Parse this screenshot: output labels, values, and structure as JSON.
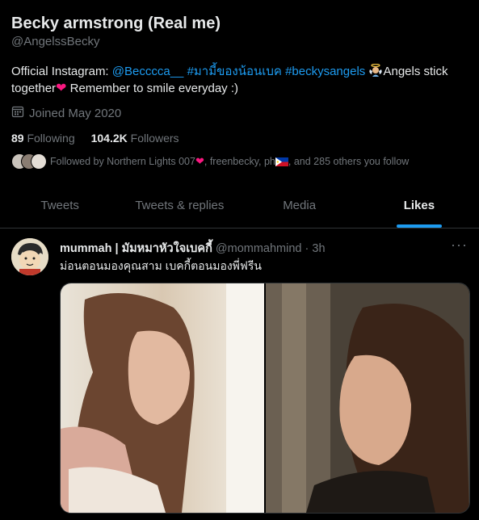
{
  "profile": {
    "name": "Becky armstrong (Real me)",
    "handle": "@AngelssBecky",
    "bio_prefix": "Official Instagram: ",
    "bio_link1": "@Becccca__",
    "bio_link2": "#มามี้ของน้อนเบค",
    "bio_link3": "#beckysangels",
    "bio_after_links": "Angels stick together",
    "bio_end": " Remember to smile everyday :)",
    "joined": "Joined May 2020",
    "following_count": "89",
    "following_label": "Following",
    "followers_count": "104.2K",
    "followers_label": "Followers",
    "followed_by_prefix": "Followed by Northern Lights 007",
    "followed_by_mid": ", freenbecky, ph",
    "followed_by_suffix": ", and 285 others you follow"
  },
  "tabs": [
    {
      "label": "Tweets"
    },
    {
      "label": "Tweets & replies"
    },
    {
      "label": "Media"
    },
    {
      "label": "Likes",
      "active": true
    }
  ],
  "tweet": {
    "display_name": "mummah | มัมหมาหัวใจเบคกี้",
    "handle": "@mommahmind",
    "separator": "·",
    "time": "3h",
    "text": "ม่อนตอนมองคุณสาม เบคกี้ตอนมองพี่ฟรีน",
    "more": "···"
  },
  "icons": {
    "calendar": "calendar-icon",
    "heart": "heart-emoji",
    "angel": "angel-emoji",
    "flag": "philippines-flag-emoji",
    "more": "more-icon"
  },
  "colors": {
    "accent": "#1d9bf0",
    "background": "#000000",
    "text": "#e7e9ea",
    "secondary": "#71767b",
    "heart": "#f91880"
  }
}
